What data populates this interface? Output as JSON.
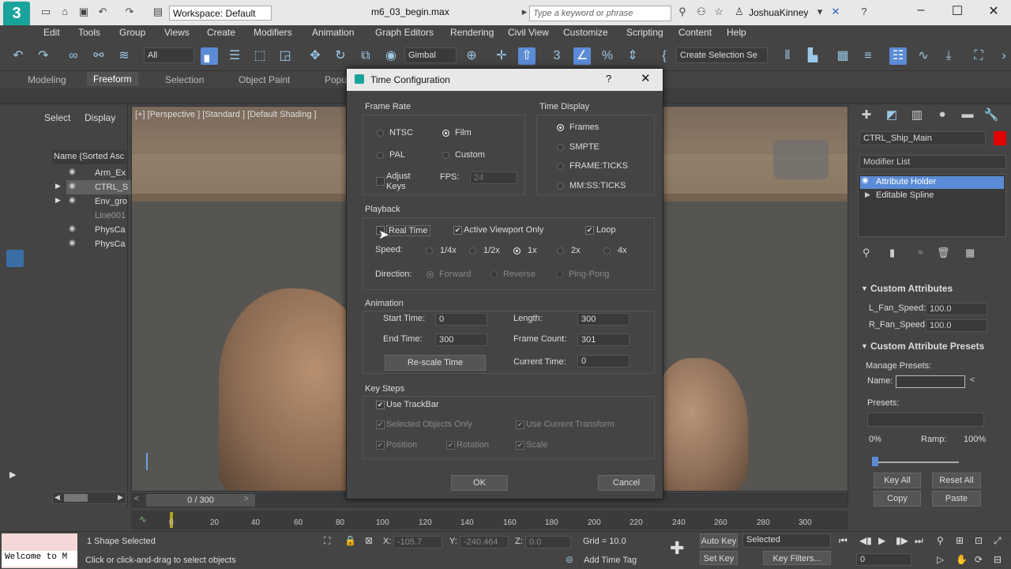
{
  "app": {
    "workspace": "Workspace: Default",
    "filename": "m6_03_begin.max",
    "search_placeholder": "Type a keyword or phrase",
    "username": "JoshuaKinney"
  },
  "menu": [
    "Edit",
    "Tools",
    "Group",
    "Views",
    "Create",
    "Modifiers",
    "Animation",
    "Graph Editors",
    "Rendering",
    "Civil View",
    "Customize",
    "Scripting",
    "Content",
    "Help"
  ],
  "toolbar": {
    "selection_filter": "All",
    "coord_system": "Gimbal",
    "selection_set": "Create Selection Se"
  },
  "ribbon_tabs": [
    "Modeling",
    "Freeform",
    "Selection",
    "Object Paint",
    "Popu"
  ],
  "scene_explorer": {
    "tabs": [
      "Select",
      "Display"
    ],
    "column_header": "Name (Sorted Asc",
    "items": [
      "Arm_Ex",
      "CTRL_S",
      "Env_gro",
      "Line001",
      "PhysCa",
      "PhysCa"
    ]
  },
  "viewport": {
    "label": "[+] [Perspective ] [Standard ] [Default Shading ]"
  },
  "timeline": {
    "frame_display": "0 / 300",
    "ticks": [
      "0",
      "20",
      "40",
      "60",
      "80",
      "100",
      "120",
      "140",
      "160",
      "180",
      "200",
      "220",
      "240",
      "260",
      "280",
      "300"
    ]
  },
  "status": {
    "selection": "1 Shape Selected",
    "prompt": "Click or click-and-drag to select objects",
    "maxscript": "Welcome to M",
    "x_label": "X:",
    "x_value": "-105.7",
    "y_label": "Y:",
    "y_value": "-240.464",
    "z_label": "Z:",
    "z_value": "0.0",
    "grid": "Grid = 10.0",
    "add_time_tag": "Add Time Tag",
    "auto_key": "Auto Key",
    "set_key": "Set Key",
    "selected": "Selected",
    "key_filters": "Key Filters...",
    "current_frame": "0"
  },
  "command_panel": {
    "object_name": "CTRL_Ship_Main",
    "object_color": "#e00000",
    "modifier_list": "Modifier List",
    "stack": [
      "Attribute Holder",
      "Editable Spline"
    ],
    "custom_attributes_title": "Custom Attributes",
    "l_fan_label": "L_Fan_Speed:",
    "l_fan_value": "100.0",
    "r_fan_label": "R_Fan_Speed:",
    "r_fan_value": "100.0",
    "presets_title": "Custom Attribute Presets",
    "manage_presets": "Manage Presets:",
    "name_label": "Name:",
    "presets_label": "Presets:",
    "pct0": "0%",
    "ramp": "Ramp:",
    "pct100": "100%",
    "key_all": "Key All",
    "reset_all": "Reset All",
    "copy": "Copy",
    "paste": "Paste"
  },
  "dialog": {
    "title": "Time Configuration",
    "frame_rate": {
      "title": "Frame Rate",
      "ntsc": "NTSC",
      "film": "Film",
      "pal": "PAL",
      "custom": "Custom",
      "adjust_keys": "Adjust Keys",
      "fps_label": "FPS:",
      "fps_value": "24"
    },
    "time_display": {
      "title": "Time Display",
      "frames": "Frames",
      "smpte": "SMPTE",
      "frame_ticks": "FRAME:TICKS",
      "mmss_ticks": "MM:SS:TICKS"
    },
    "playback": {
      "title": "Playback",
      "real_time": "Real Time",
      "active_viewport_only": "Active Viewport Only",
      "loop": "Loop",
      "speed_label": "Speed:",
      "speeds": [
        "1/4x",
        "1/2x",
        "1x",
        "2x",
        "4x"
      ],
      "direction_label": "Direction:",
      "forward": "Forward",
      "reverse": "Reverse",
      "ping_pong": "Ping-Pong"
    },
    "animation": {
      "title": "Animation",
      "start_time_label": "Start Time:",
      "start_time": "0",
      "end_time_label": "End Time:",
      "end_time": "300",
      "length_label": "Length:",
      "length": "300",
      "frame_count_label": "Frame Count:",
      "frame_count": "301",
      "rescale": "Re-scale Time",
      "current_time_label": "Current Time:",
      "current_time": "0"
    },
    "key_steps": {
      "title": "Key Steps",
      "use_trackbar": "Use TrackBar",
      "selected_only": "Selected Objects Only",
      "use_current_transform": "Use Current Transform",
      "position": "Position",
      "rotation": "Rotation",
      "scale": "Scale"
    },
    "ok": "OK",
    "cancel": "Cancel"
  }
}
